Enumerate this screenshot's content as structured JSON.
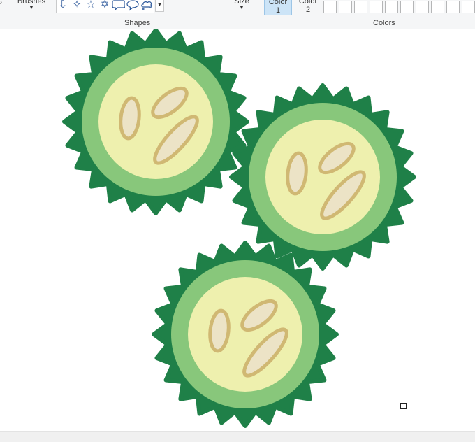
{
  "ribbon": {
    "brushes_label": "Brushes",
    "shapes_group_label": "Shapes",
    "size_label": "Size",
    "color1": {
      "line1": "Color",
      "line2": "1"
    },
    "color2": {
      "line1": "Color",
      "line2": "2"
    },
    "colors_group_label": "Colors",
    "shape_icons": [
      "down-arrow-icon",
      "four-point-star-icon",
      "five-point-star-icon",
      "six-point-star-icon",
      "rounded-rectangle-callout-icon",
      "oval-callout-icon",
      "cloud-callout-icon"
    ],
    "custom_swatch_count": 10,
    "colors": {
      "toolbar_bg": "#f5f6f7",
      "selected_color_button": "#cce4f7",
      "shape_icon": "#2b579a"
    }
  },
  "canvas": {
    "image": "three-cucumber-slices",
    "colors": {
      "rind_dark": "#1f8048",
      "rind_light": "#88c77b",
      "flesh": "#eef0ae",
      "seed_fill": "#ece3c6",
      "seed_outline": "#d0b873"
    }
  }
}
